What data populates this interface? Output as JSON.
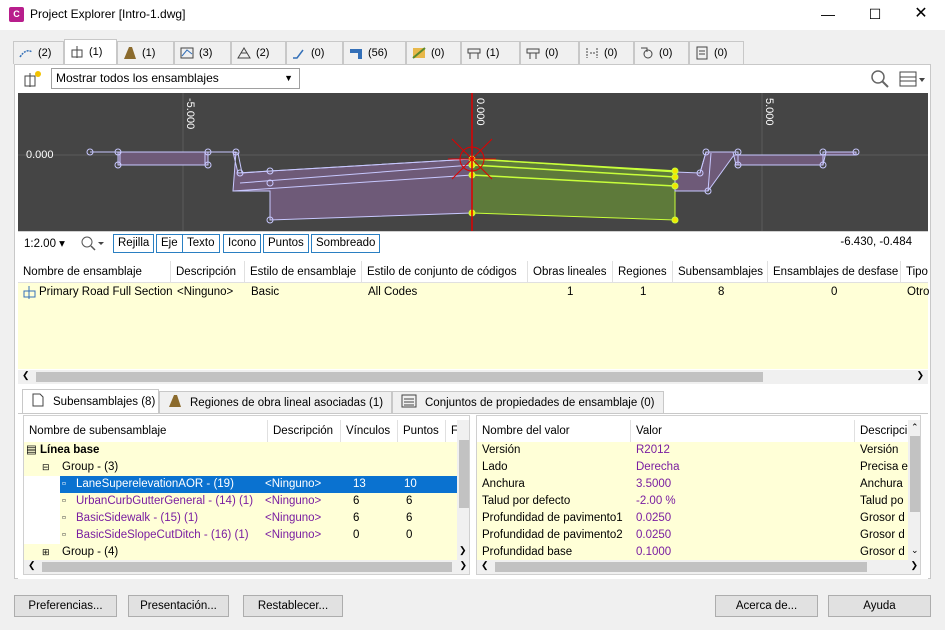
{
  "window": {
    "title": "Project Explorer [Intro-1.dwg]",
    "app_icon_text": "C"
  },
  "tabs": [
    {
      "count": "(2)",
      "icon": "alignment-icon"
    },
    {
      "count": "(1)",
      "icon": "assembly-icon"
    },
    {
      "count": "(1)",
      "icon": "corridor-icon"
    },
    {
      "count": "(3)",
      "icon": "profile-icon"
    },
    {
      "count": "(2)",
      "icon": "surface-icon"
    },
    {
      "count": "(0)",
      "icon": "featureline-icon"
    },
    {
      "count": "(56)",
      "icon": "sampleline-icon"
    },
    {
      "count": "(0)",
      "icon": "parcel-icon"
    },
    {
      "count": "(1)",
      "icon": "section-icon"
    },
    {
      "count": "(0)",
      "icon": "sectionview-icon"
    },
    {
      "count": "(0)",
      "icon": "offset-icon"
    },
    {
      "count": "(0)",
      "icon": "intersection-icon"
    },
    {
      "count": "(0)",
      "icon": "report-icon"
    }
  ],
  "toolbar": {
    "filter_value": "Mostrar todos los ensamblajes"
  },
  "preview": {
    "axis_labels": [
      "-5.000",
      "0.000",
      "5.000"
    ],
    "y_label": "0.000",
    "zoom": "1:2.00",
    "buttons": [
      "Rejilla",
      "Eje",
      "Texto",
      "Icono",
      "Puntos",
      "Sombreado"
    ],
    "coords": "-6.430, -0.484"
  },
  "assemblies": {
    "columns": [
      "Nombre de ensamblaje",
      "Descripción",
      "Estilo de ensamblaje",
      "Estilo de conjunto de códigos",
      "Obras lineales",
      "Regiones",
      "Subensamblajes",
      "Ensamblajes de desfase",
      "Tipo"
    ],
    "row": [
      "Primary Road Full Section",
      "<Ninguno>",
      "Basic",
      "All Codes",
      "1",
      "1",
      "8",
      "0",
      "Otro"
    ]
  },
  "bottom_tabs": [
    "Subensamblajes (8)",
    "Regiones de obra lineal asociadas (1)",
    "Conjuntos de propiedades de ensamblaje (0)"
  ],
  "subassemblies": {
    "columns": [
      "Nombre de subensamblaje",
      "Descripción",
      "Vínculos",
      "Puntos",
      "F"
    ],
    "baseline": "Línea base",
    "group1": "Group - (3)",
    "rows": [
      {
        "name": "LaneSuperelevationAOR - (19)",
        "desc": "<Ninguno>",
        "links": "13",
        "points": "10"
      },
      {
        "name": "UrbanCurbGutterGeneral - (14) (1)",
        "desc": "<Ninguno>",
        "links": "6",
        "points": "6"
      },
      {
        "name": "BasicSidewalk - (15) (1)",
        "desc": "<Ninguno>",
        "links": "6",
        "points": "6"
      },
      {
        "name": "BasicSideSlopeCutDitch - (16) (1)",
        "desc": "<Ninguno>",
        "links": "0",
        "points": "0"
      }
    ],
    "group2": "Group - (4)"
  },
  "properties": {
    "columns": [
      "Nombre del valor",
      "Valor",
      "Descripci"
    ],
    "rows": [
      {
        "name": "Versión",
        "value": "R2012",
        "desc": "Versión"
      },
      {
        "name": "Lado",
        "value": "Derecha",
        "desc": "Precisa e"
      },
      {
        "name": "Anchura",
        "value": "3.5000",
        "desc": "Anchura"
      },
      {
        "name": "Talud por defecto",
        "value": "-2.00 %",
        "desc": "Talud po"
      },
      {
        "name": "Profundidad de pavimento1",
        "value": "0.0250",
        "desc": "Grosor d"
      },
      {
        "name": "Profundidad de pavimento2",
        "value": "0.0250",
        "desc": "Grosor d"
      },
      {
        "name": "Profundidad base",
        "value": "0.1000",
        "desc": "Grosor d"
      }
    ]
  },
  "footer": {
    "preferences": "Preferencias...",
    "presentation": "Presentación...",
    "reset": "Restablecer...",
    "about": "Acerca de...",
    "help": "Ayuda"
  }
}
